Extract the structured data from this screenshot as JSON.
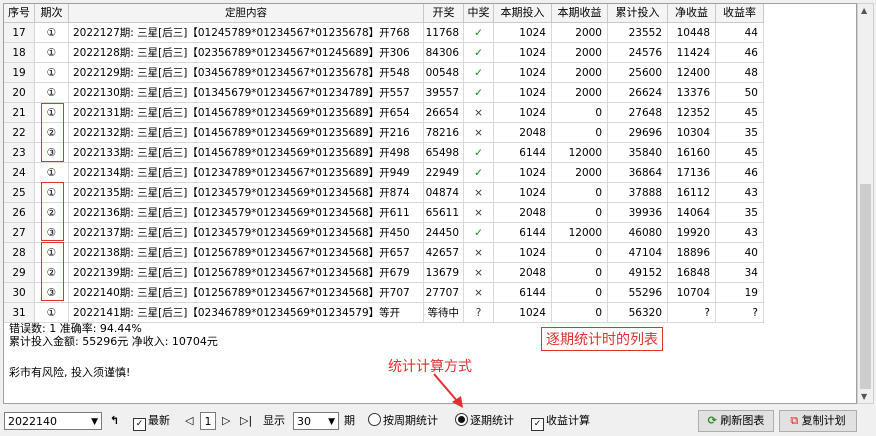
{
  "headers": [
    "序号",
    "期次",
    "定胆内容",
    "开奖",
    "中奖",
    "本期投入",
    "本期收益",
    "累计投入",
    "净收益",
    "收益率"
  ],
  "rows": [
    {
      "no": "17",
      "step": "①",
      "content": "2022127期: 三星[后三]【01245789*01234567*01235678】开768",
      "draw": "11768",
      "win": "✓",
      "bet": "1024",
      "gain": "2000",
      "cum": "23552",
      "net": "10448",
      "rate": "44"
    },
    {
      "no": "18",
      "step": "①",
      "content": "2022128期: 三星[后三]【02356789*01234567*01245689】开306",
      "draw": "84306",
      "win": "✓",
      "bet": "1024",
      "gain": "2000",
      "cum": "24576",
      "net": "11424",
      "rate": "46"
    },
    {
      "no": "19",
      "step": "①",
      "content": "2022129期: 三星[后三]【03456789*01234567*01235678】开548",
      "draw": "00548",
      "win": "✓",
      "bet": "1024",
      "gain": "2000",
      "cum": "25600",
      "net": "12400",
      "rate": "48"
    },
    {
      "no": "20",
      "step": "①",
      "content": "2022130期: 三星[后三]【01345679*01234567*01234789】开557",
      "draw": "39557",
      "win": "✓",
      "bet": "1024",
      "gain": "2000",
      "cum": "26624",
      "net": "13376",
      "rate": "50"
    },
    {
      "no": "21",
      "step": "①",
      "content": "2022131期: 三星[后三]【01456789*01234569*01235689】开654",
      "draw": "26654",
      "win": "×",
      "bet": "1024",
      "gain": "0",
      "cum": "27648",
      "net": "12352",
      "rate": "45"
    },
    {
      "no": "22",
      "step": "②",
      "content": "2022132期: 三星[后三]【01456789*01234569*01235689】开216",
      "draw": "78216",
      "win": "×",
      "bet": "2048",
      "gain": "0",
      "cum": "29696",
      "net": "10304",
      "rate": "35"
    },
    {
      "no": "23",
      "step": "③",
      "content": "2022133期: 三星[后三]【01456789*01234569*01235689】开498",
      "draw": "65498",
      "win": "✓",
      "bet": "6144",
      "gain": "12000",
      "cum": "35840",
      "net": "16160",
      "rate": "45"
    },
    {
      "no": "24",
      "step": "①",
      "content": "2022134期: 三星[后三]【01234789*01234567*01235689】开949",
      "draw": "22949",
      "win": "✓",
      "bet": "1024",
      "gain": "2000",
      "cum": "36864",
      "net": "17136",
      "rate": "46"
    },
    {
      "no": "25",
      "step": "①",
      "content": "2022135期: 三星[后三]【01234579*01234569*01234568】开874",
      "draw": "04874",
      "win": "×",
      "bet": "1024",
      "gain": "0",
      "cum": "37888",
      "net": "16112",
      "rate": "43"
    },
    {
      "no": "26",
      "step": "②",
      "content": "2022136期: 三星[后三]【01234579*01234569*01234568】开611",
      "draw": "65611",
      "win": "×",
      "bet": "2048",
      "gain": "0",
      "cum": "39936",
      "net": "14064",
      "rate": "35"
    },
    {
      "no": "27",
      "step": "③",
      "content": "2022137期: 三星[后三]【01234579*01234569*01234568】开450",
      "draw": "24450",
      "win": "✓",
      "bet": "6144",
      "gain": "12000",
      "cum": "46080",
      "net": "19920",
      "rate": "43"
    },
    {
      "no": "28",
      "step": "①",
      "content": "2022138期: 三星[后三]【01256789*01234567*01234568】开657",
      "draw": "42657",
      "win": "×",
      "bet": "1024",
      "gain": "0",
      "cum": "47104",
      "net": "18896",
      "rate": "40"
    },
    {
      "no": "29",
      "step": "②",
      "content": "2022139期: 三星[后三]【01256789*01234567*01234568】开679",
      "draw": "13679",
      "win": "×",
      "bet": "2048",
      "gain": "0",
      "cum": "49152",
      "net": "16848",
      "rate": "34"
    },
    {
      "no": "30",
      "step": "③",
      "content": "2022140期: 三星[后三]【01256789*01234567*01234568】开707",
      "draw": "27707",
      "win": "×",
      "bet": "6144",
      "gain": "0",
      "cum": "55296",
      "net": "10704",
      "rate": "19"
    },
    {
      "no": "31",
      "step": "①",
      "content": "2022141期: 三星[后三]【02346789*01234569*01234579】等开",
      "draw": "等待中",
      "win": "?",
      "bet": "1024",
      "gain": "0",
      "cum": "56320",
      "net": "?",
      "rate": "?"
    }
  ],
  "summary": {
    "line1": "错误数: 1  准确率: 94.44%",
    "line2": "累计投入金额: 55296元  净收入: 10704元",
    "line3": "彩市有风险, 投入须谨慎!"
  },
  "annotations": {
    "list_note": "逐期统计时的列表",
    "method_note": "统计计算方式"
  },
  "toolbar": {
    "period_select": "2022140",
    "latest_label": "最新",
    "page_value": "1",
    "show_label": "显示",
    "count_select": "30",
    "period_unit": "期",
    "radio_cycle": "按周期统计",
    "radio_each": "逐期统计",
    "profit_calc": "收益计算",
    "refresh_button": "刷新图表",
    "copy_button": "复制计划"
  },
  "colors": {
    "accent_red": "#e03030",
    "win_green": "#118811"
  }
}
